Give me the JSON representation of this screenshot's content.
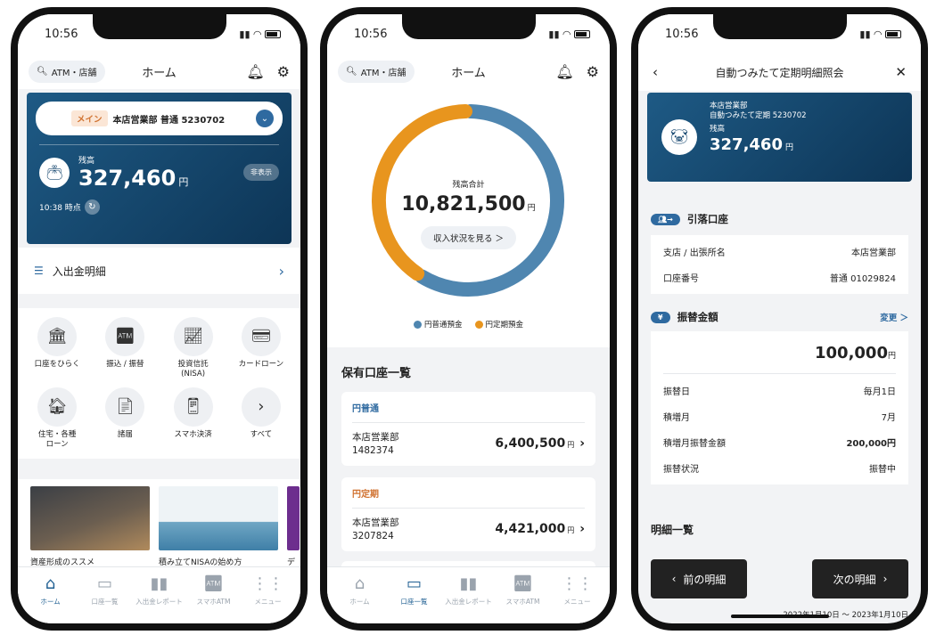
{
  "status_time": "10:56",
  "phone1": {
    "search_label": "ATM・店舗",
    "title": "ホーム",
    "main_badge": "メイン",
    "account_label": "本店営業部 普通 5230702",
    "balance_label": "残高",
    "balance": "327,460",
    "yen": "円",
    "hide_label": "非表示",
    "as_of": "10:38 時点",
    "statement_link": "入出金明細",
    "grid": [
      {
        "label": "口座をひらく",
        "icon": "bank-icon"
      },
      {
        "label": "振込 / 振替",
        "icon": "atm-icon"
      },
      {
        "label": "投資信託\n(NISA)",
        "icon": "chart-icon"
      },
      {
        "label": "カードローン",
        "icon": "card-icon"
      },
      {
        "label": "住宅・各種\nローン",
        "icon": "house-icon"
      },
      {
        "label": "諸届",
        "icon": "document-icon"
      },
      {
        "label": "スマホ決済",
        "icon": "phone-pay-icon"
      },
      {
        "label": "すべて",
        "icon": "chevron-right-icon"
      }
    ],
    "banners": [
      {
        "caption": "資産形成のススメ"
      },
      {
        "caption": "積み立てNISAの始め方"
      },
      {
        "caption": "デ"
      }
    ]
  },
  "tabs": [
    {
      "label": "ホーム",
      "icon": "home-icon"
    },
    {
      "label": "口座一覧",
      "icon": "wallet-icon"
    },
    {
      "label": "入出金レポート",
      "icon": "bar-chart-icon"
    },
    {
      "label": "スマホATM",
      "icon": "atm-icon"
    },
    {
      "label": "メニュー",
      "icon": "menu-icon"
    }
  ],
  "phone2": {
    "search_label": "ATM・店舗",
    "title": "ホーム",
    "total_label": "残高合計",
    "total": "10,821,500",
    "yen": "円",
    "status_button": "収入状況を見る ＞",
    "legend": [
      {
        "label": "円普通預金",
        "color": "#4f86b0"
      },
      {
        "label": "円定期預金",
        "color": "#e8951e"
      }
    ],
    "donut": {
      "ordinary": 6400500,
      "time": 4421000
    },
    "section_title": "保有口座一覧",
    "accounts": [
      {
        "type": "円普通",
        "branch": "本店営業部",
        "number": "1482374",
        "amount": "6,400,500"
      },
      {
        "type": "円定期",
        "branch": "本店営業部",
        "number": "3207824",
        "amount": "4,421,000"
      }
    ]
  },
  "phone3": {
    "title": "自動つみたて定期明細照会",
    "branch": "本店営業部",
    "product": "自動つみたて定期 5230702",
    "balance_label": "残高",
    "balance": "327,460",
    "yen": "円",
    "debit_title": "引落口座",
    "debit_rows": [
      {
        "k": "支店 / 出張所名",
        "v": "本店営業部"
      },
      {
        "k": "口座番号",
        "v": "普通 01029824"
      }
    ],
    "transfer_title": "振替金額",
    "change_link": "変更 ＞",
    "transfer_amount": "100,000",
    "transfer_rows": [
      {
        "k": "振替日",
        "v": "毎月1日"
      },
      {
        "k": "積増月",
        "v": "7月"
      },
      {
        "k": "積増月振替金額",
        "v": "200,000円"
      },
      {
        "k": "振替状況",
        "v": "振替中"
      }
    ],
    "list_title": "明細一覧",
    "prev_button": "前の明細",
    "next_button": "次の明細",
    "period": "2022年1月10日 ～ 2023年1月10日"
  }
}
